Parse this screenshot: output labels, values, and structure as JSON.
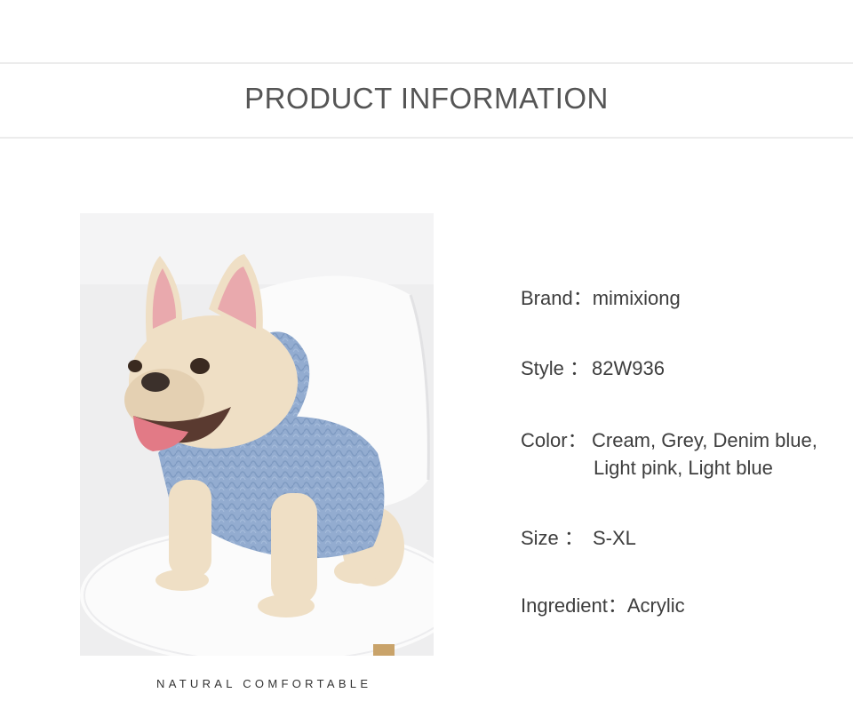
{
  "header": {
    "title": "PRODUCT INFORMATION"
  },
  "product_image": {
    "caption": "NATURAL COMFORTABLE"
  },
  "specs": {
    "brand": {
      "label": "Brand：",
      "value": "mimixiong"
    },
    "style": {
      "label": "Style ：",
      "value": "82W936"
    },
    "color": {
      "label": "Color：",
      "value_line1": "Cream, Grey, Denim blue,",
      "value_line2": "Light pink, Light blue"
    },
    "size": {
      "label": "Size ：",
      "value": "S-XL"
    },
    "ingredient": {
      "label": "Ingredient：",
      "value": "Acrylic"
    }
  },
  "colors": {
    "sweater": "#93acd0",
    "dog": "#efdfc5",
    "chair": "#fbfbfb",
    "background": "#eeeeef"
  }
}
